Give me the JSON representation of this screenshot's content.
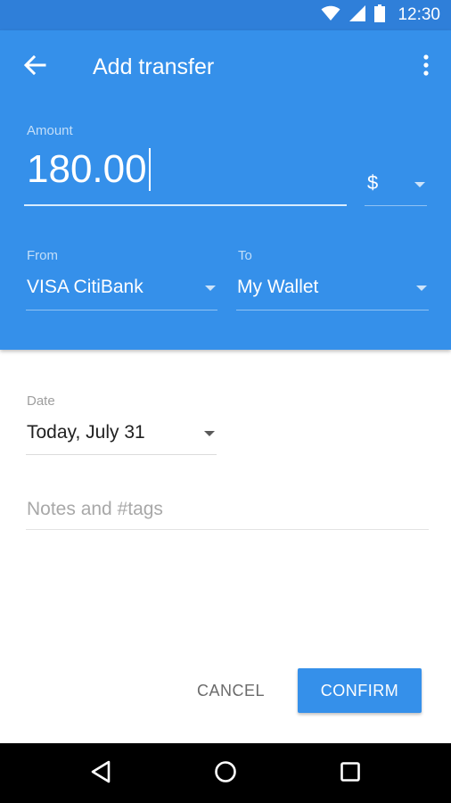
{
  "status_bar": {
    "time": "12:30",
    "icons": [
      "wifi-icon",
      "cellular-signal-icon",
      "battery-icon"
    ],
    "color": "#2f7fd9"
  },
  "toolbar": {
    "title": "Add transfer",
    "back_icon": "arrow-back-icon",
    "menu_icon": "more-vert-icon",
    "color": "#3590ea"
  },
  "amount": {
    "label": "Amount",
    "value": "180.00"
  },
  "currency": {
    "value": "$"
  },
  "from": {
    "label": "From",
    "value": "VISA CitiBank"
  },
  "to": {
    "label": "To",
    "value": "My Wallet"
  },
  "date": {
    "label": "Date",
    "value": "Today, July 31"
  },
  "notes": {
    "placeholder": "Notes and #tags",
    "value": ""
  },
  "actions": {
    "cancel_label": "CANCEL",
    "confirm_label": "CONFIRM"
  },
  "nav_bar": {
    "icons": [
      "back-triangle-icon",
      "home-circle-icon",
      "recents-square-icon"
    ]
  }
}
